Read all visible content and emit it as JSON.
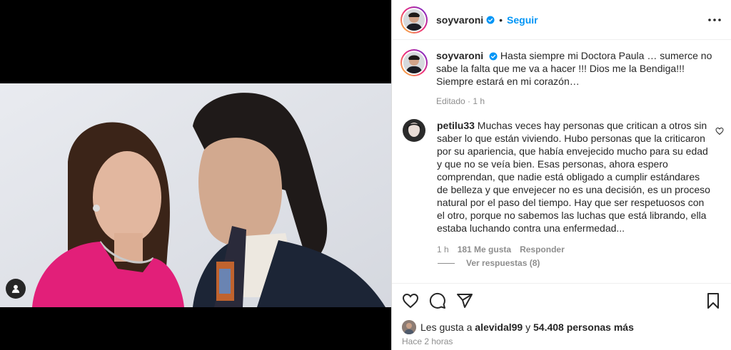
{
  "header": {
    "username": "soyvaroni",
    "separator": "•",
    "follow_label": "Seguir"
  },
  "caption": {
    "username": "soyvaroni",
    "text": "Hasta siempre mi Doctora Paula … sumerce no sabe la falta que me va a hacer !!! Dios me la Bendiga!!! Siempre estará en mi corazón…",
    "edited_label": "Editado",
    "separator": "·",
    "time": "1 h"
  },
  "comment": {
    "username": "petilu33",
    "text": "Muchas veces hay personas que critican a otros sin saber lo que están viviendo. Hubo personas que la criticaron por su apariencia, que había envejecido mucho para su edad y que no se veía bien. Esas personas, ahora espero comprendan, que nadie está obligado a cumplir estándares de belleza y que envejecer no es una decisión, es un proceso natural por el paso del tiempo. Hay que ser respetuosos con el otro, porque no sabemos las luchas que está librando, ella estaba luchando contra una enfermedad...",
    "time": "1 h",
    "likes": "181 Me gusta",
    "reply_label": "Responder",
    "view_replies": "Ver respuestas (8)"
  },
  "likes_line": {
    "prefix": "Les gusta a",
    "user": "alevidal99",
    "conj": "y",
    "others": "54.408 personas más"
  },
  "posted_time": "Hace 2 horas",
  "icons": {
    "verified": "verified-badge-icon",
    "more": "more-options-icon",
    "like": "heart-icon",
    "comment": "comment-icon",
    "share": "share-icon",
    "save": "bookmark-icon",
    "tag": "user-tag-icon"
  },
  "colors": {
    "follow_blue": "#0095f6",
    "muted": "#8e8e8e",
    "text": "#262626",
    "verified": "#0095f6"
  }
}
